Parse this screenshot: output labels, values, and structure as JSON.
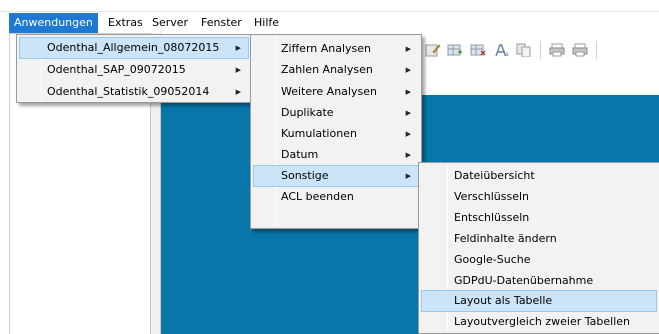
{
  "menubar": {
    "items": [
      {
        "label": "Anwendungen",
        "active": true
      },
      {
        "label": "Extras",
        "active": false
      },
      {
        "label": "Server",
        "active": false
      },
      {
        "label": "Fenster",
        "active": false
      },
      {
        "label": "Hilfe",
        "active": false
      }
    ]
  },
  "menu_level1": {
    "items": [
      {
        "label": "Odenthal_Allgemein_08072015",
        "has_submenu": true,
        "highlighted": true
      },
      {
        "label": "Odenthal_SAP_09072015",
        "has_submenu": true,
        "highlighted": false
      },
      {
        "label": "Odenthal_Statistik_09052014",
        "has_submenu": true,
        "highlighted": false
      }
    ]
  },
  "menu_level2": {
    "items": [
      {
        "label": "Ziffern Analysen",
        "has_submenu": true,
        "highlighted": false
      },
      {
        "label": "Zahlen Analysen",
        "has_submenu": true,
        "highlighted": false
      },
      {
        "label": "Weitere Analysen",
        "has_submenu": true,
        "highlighted": false
      },
      {
        "label": "Duplikate",
        "has_submenu": true,
        "highlighted": false
      },
      {
        "label": "Kumulationen",
        "has_submenu": true,
        "highlighted": false
      },
      {
        "label": "Datum",
        "has_submenu": true,
        "highlighted": false
      },
      {
        "label": "Sonstige",
        "has_submenu": true,
        "highlighted": true
      },
      {
        "label": "ACL beenden",
        "has_submenu": false,
        "highlighted": false
      }
    ]
  },
  "menu_level3": {
    "items": [
      {
        "label": "Dateiübersicht",
        "highlighted": false
      },
      {
        "label": "Verschlüsseln",
        "highlighted": false
      },
      {
        "label": "Entschlüsseln",
        "highlighted": false
      },
      {
        "label": "Feldinhalte ändern",
        "highlighted": false
      },
      {
        "label": "Google-Suche",
        "highlighted": false
      },
      {
        "label": "GDPdU-Datenübernahme",
        "highlighted": false
      },
      {
        "label": "Layout als Tabelle",
        "highlighted": true
      },
      {
        "label": "Layoutvergleich zweier Tabellen",
        "highlighted": false
      }
    ]
  },
  "toolbar": {
    "icons": [
      "edit-icon",
      "table-add-icon",
      "table-delete-icon",
      "font-icon",
      "copy-icon",
      "print-preview-icon",
      "print-icon"
    ]
  },
  "colors": {
    "menubar_active": "#1e79d4",
    "menu_highlight": "#cce4f7",
    "workspace": "#0876a8"
  }
}
